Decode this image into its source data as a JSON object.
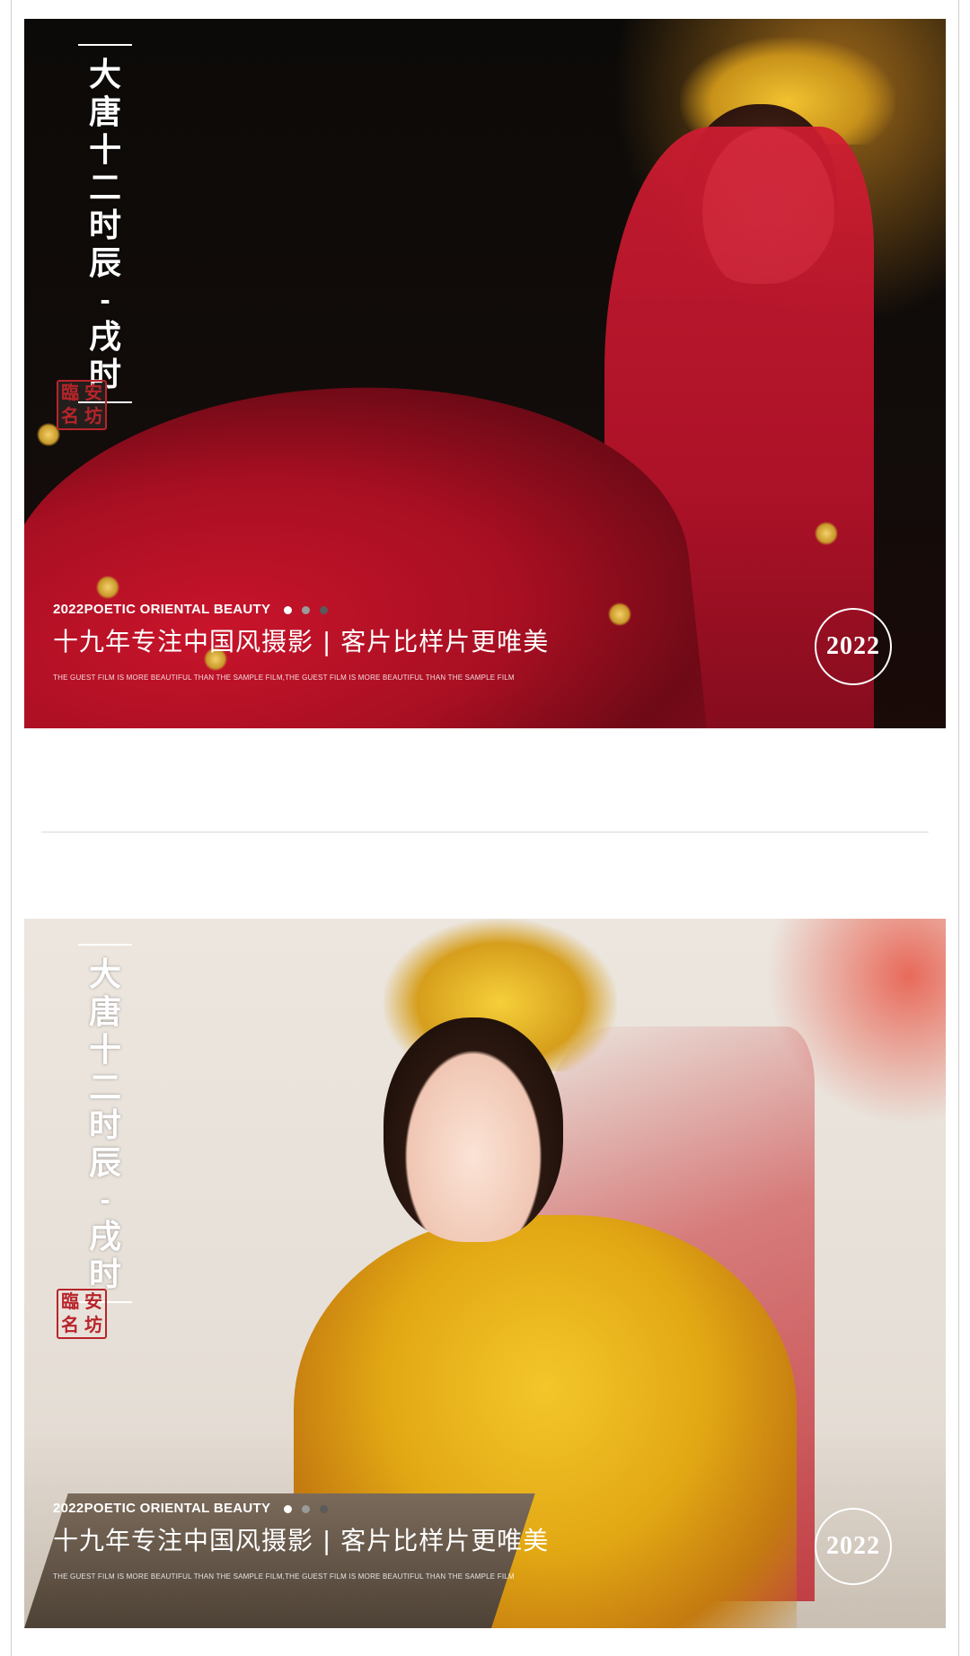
{
  "photos": [
    {
      "title_chars": [
        "大",
        "唐",
        "十",
        "二",
        "时",
        "辰"
      ],
      "title_dash": "-",
      "title_tail": [
        "戌",
        "时"
      ],
      "seal_chars": [
        "臨",
        "安",
        "名",
        "坊"
      ],
      "tag_en": "2022POETIC ORIENTAL BEAUTY",
      "tag_cn": "十九年专注中国风摄影 | 客片比样片更唯美",
      "tag_small": "THE GUEST FILM IS MORE BEAUTIFUL THAN THE SAMPLE FILM,THE GUEST FILM IS MORE BEAUTIFUL THAN THE SAMPLE FILM",
      "year": "2022",
      "dot_colors": [
        "#ffffff",
        "#9a9a9a",
        "#5a5a5a"
      ]
    },
    {
      "title_chars": [
        "大",
        "唐",
        "十",
        "二",
        "时",
        "辰"
      ],
      "title_dash": "-",
      "title_tail": [
        "戌",
        "时"
      ],
      "seal_chars": [
        "臨",
        "安",
        "名",
        "坊"
      ],
      "tag_en": "2022POETIC ORIENTAL BEAUTY",
      "tag_cn": "十九年专注中国风摄影 | 客片比样片更唯美",
      "tag_small": "THE GUEST FILM IS MORE BEAUTIFUL THAN THE SAMPLE FILM,THE GUEST FILM IS MORE BEAUTIFUL THAN THE SAMPLE FILM",
      "year": "2022",
      "dot_colors": [
        "#ffffff",
        "#9a9a9a",
        "#5a5a5a"
      ]
    }
  ]
}
